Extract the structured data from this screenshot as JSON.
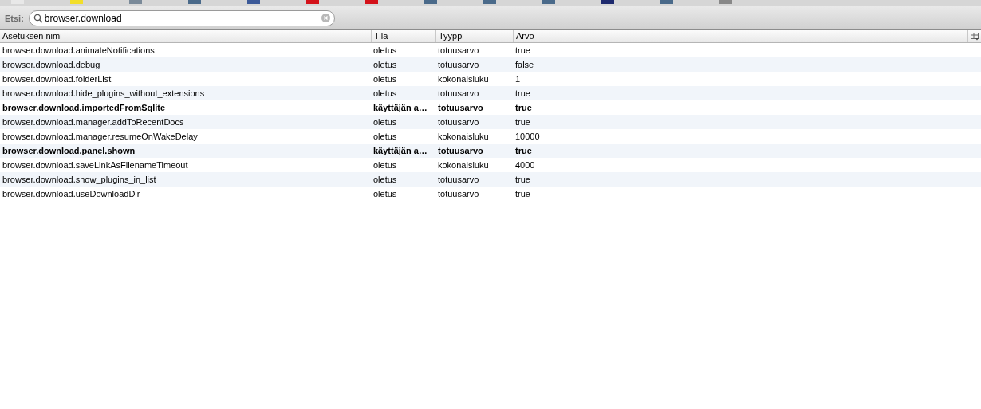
{
  "bookmarks_bar": {
    "favicons": [
      {
        "color": "#e8e8e8"
      },
      {
        "color": "#f2de2a"
      },
      {
        "color": "#7a8a99"
      },
      {
        "color": "#4a6a8a"
      },
      {
        "color": "#3b5998"
      },
      {
        "color": "#d4121a"
      },
      {
        "color": "#d4121a"
      },
      {
        "color": "#4a6a8a"
      },
      {
        "color": "#4a6a8a"
      },
      {
        "color": "#4a6a8a"
      },
      {
        "color": "#1e2a6e"
      },
      {
        "color": "#4a6a8a"
      },
      {
        "color": "#888888"
      }
    ]
  },
  "search": {
    "label": "Etsi:",
    "value": "browser.download"
  },
  "table": {
    "columns": [
      "Asetuksen nimi",
      "Tila",
      "Tyyppi",
      "Arvo"
    ],
    "rows": [
      {
        "name": "browser.download.animateNotifications",
        "status": "oletus",
        "type": "totuusarvo",
        "value": "true",
        "modified": false
      },
      {
        "name": "browser.download.debug",
        "status": "oletus",
        "type": "totuusarvo",
        "value": "false",
        "modified": false
      },
      {
        "name": "browser.download.folderList",
        "status": "oletus",
        "type": "kokonaisluku",
        "value": "1",
        "modified": false
      },
      {
        "name": "browser.download.hide_plugins_without_extensions",
        "status": "oletus",
        "type": "totuusarvo",
        "value": "true",
        "modified": false
      },
      {
        "name": "browser.download.importedFromSqlite",
        "status": "käyttäjän a…",
        "type": "totuusarvo",
        "value": "true",
        "modified": true
      },
      {
        "name": "browser.download.manager.addToRecentDocs",
        "status": "oletus",
        "type": "totuusarvo",
        "value": "true",
        "modified": false
      },
      {
        "name": "browser.download.manager.resumeOnWakeDelay",
        "status": "oletus",
        "type": "kokonaisluku",
        "value": "10000",
        "modified": false
      },
      {
        "name": "browser.download.panel.shown",
        "status": "käyttäjän a…",
        "type": "totuusarvo",
        "value": "true",
        "modified": true
      },
      {
        "name": "browser.download.saveLinkAsFilenameTimeout",
        "status": "oletus",
        "type": "kokonaisluku",
        "value": "4000",
        "modified": false
      },
      {
        "name": "browser.download.show_plugins_in_list",
        "status": "oletus",
        "type": "totuusarvo",
        "value": "true",
        "modified": false
      },
      {
        "name": "browser.download.useDownloadDir",
        "status": "oletus",
        "type": "totuusarvo",
        "value": "true",
        "modified": false
      }
    ]
  }
}
